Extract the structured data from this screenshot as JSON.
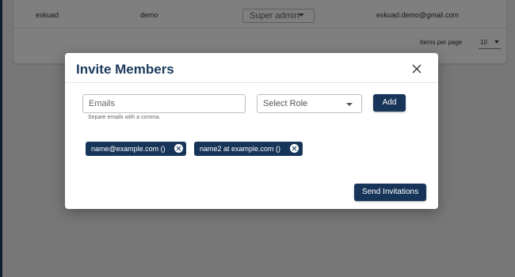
{
  "background": {
    "member_row": {
      "name": "eskuad",
      "workspace": "demo",
      "role": "Super admin",
      "email": "eskuad.demo@gmail.com"
    },
    "pagination": {
      "items_per_page_label": "Items per page",
      "items_per_page_value": "10"
    }
  },
  "modal": {
    "title": "Invite Members",
    "close_icon": "close-icon",
    "emails_placeholder": "Emails",
    "emails_hint": "Separe emails with a comma",
    "role_placeholder": "Select Role",
    "add_label": "Add",
    "chips": [
      {
        "label": "name@example.com ()"
      },
      {
        "label": "name2 at example.com ()"
      }
    ],
    "send_label": "Send Invitations"
  },
  "colors": {
    "primary": "#173559",
    "title": "#1b3a5c",
    "overlay": "rgba(0,0,0,0.5)"
  }
}
